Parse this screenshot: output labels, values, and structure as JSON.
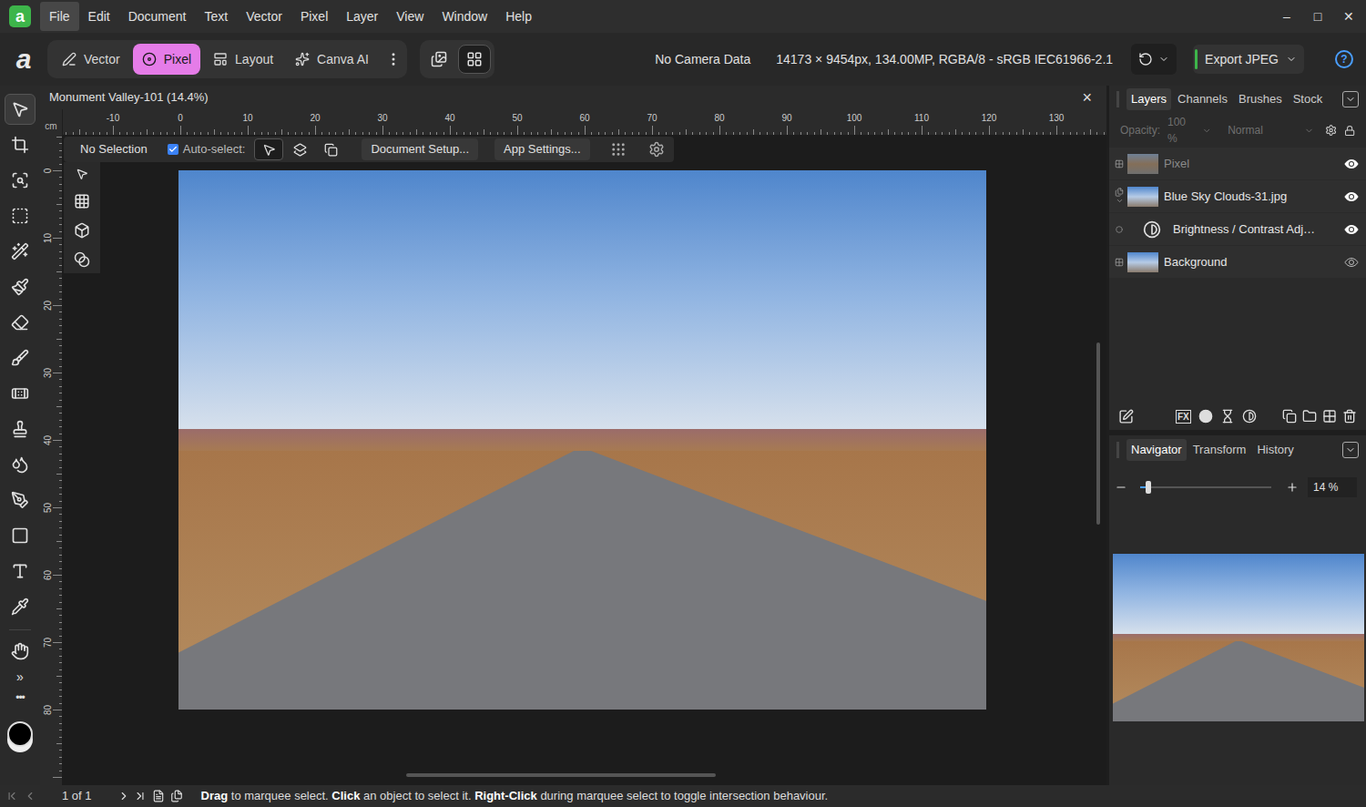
{
  "logo": "a",
  "window_controls": [
    "–",
    "□",
    "✕"
  ],
  "menu": [
    {
      "label": "File",
      "selected": true
    },
    {
      "label": "Edit",
      "selected": false
    },
    {
      "label": "Document",
      "selected": false
    },
    {
      "label": "Text",
      "selected": false
    },
    {
      "label": "Vector",
      "selected": false
    },
    {
      "label": "Pixel",
      "selected": false
    },
    {
      "label": "Layer",
      "selected": false
    },
    {
      "label": "View",
      "selected": false
    },
    {
      "label": "Window",
      "selected": false
    },
    {
      "label": "Help",
      "selected": false
    }
  ],
  "personas": [
    {
      "label": "Vector",
      "selected": false
    },
    {
      "label": "Pixel",
      "selected": true
    },
    {
      "label": "Layout",
      "selected": false
    },
    {
      "label": "Canva AI",
      "selected": false
    }
  ],
  "info": {
    "camera": "No Camera Data",
    "document": "14173 × 9454px, 134.00MP, RGBA/8 - sRGB IEC61966-2.1"
  },
  "export": {
    "label": "Export JPEG"
  },
  "help": "?",
  "tools": {
    "more": "»",
    "overflow": "•••"
  },
  "document": {
    "title": "Monument Valley-101 (14.4%)",
    "close": "×"
  },
  "rulers": {
    "unit": "cm",
    "horizontal": [
      "-10",
      "0",
      "10",
      "20",
      "30",
      "40",
      "50",
      "60",
      "70",
      "80",
      "90",
      "100",
      "110",
      "120",
      "130"
    ],
    "vertical": [
      "0",
      "10",
      "20",
      "30",
      "40",
      "50",
      "60",
      "70",
      "80"
    ]
  },
  "context_toolbar": {
    "selection": "No Selection",
    "auto_select": {
      "label": "Auto-select:",
      "checked": true
    },
    "buttons": [
      "Document Setup...",
      "App Settings..."
    ]
  },
  "layers_panel": {
    "tabs": [
      {
        "label": "Layers",
        "selected": true
      },
      {
        "label": "Channels",
        "selected": false
      },
      {
        "label": "Brushes",
        "selected": false
      },
      {
        "label": "Stock",
        "selected": false
      }
    ],
    "opacity_label": "Opacity:",
    "opacity": "100 %",
    "blend_mode": "Normal",
    "disabled": true,
    "fx": "FX",
    "layers": [
      {
        "name": "Pixel",
        "kind": "pixel",
        "visible": true,
        "dimmed": true,
        "child": false,
        "expanded": false
      },
      {
        "name": "Blue Sky Clouds-31.jpg",
        "kind": "image",
        "visible": true,
        "dimmed": false,
        "child": false,
        "expanded": true
      },
      {
        "name": "Brightness / Contrast Adj…",
        "kind": "adjustment",
        "visible": true,
        "dimmed": false,
        "child": true,
        "expanded": false
      },
      {
        "name": "Background",
        "kind": "image",
        "visible": false,
        "dimmed": false,
        "child": false,
        "expanded": false
      }
    ]
  },
  "navigator_panel": {
    "tabs": [
      {
        "label": "Navigator",
        "selected": true
      },
      {
        "label": "Transform",
        "selected": false
      },
      {
        "label": "History",
        "selected": false
      }
    ],
    "zoom": {
      "level": 0.06,
      "reading": "14 %"
    }
  },
  "status_bar": {
    "page": "1 of 1",
    "hint": [
      {
        "text": "Drag",
        "bold": true
      },
      {
        "text": " to marquee select. ",
        "bold": false
      },
      {
        "text": "Click",
        "bold": true
      },
      {
        "text": " an object to select it. ",
        "bold": false
      },
      {
        "text": "Right-Click",
        "bold": true
      },
      {
        "text": " during marquee select to toggle intersection behaviour.",
        "bold": false
      }
    ]
  }
}
